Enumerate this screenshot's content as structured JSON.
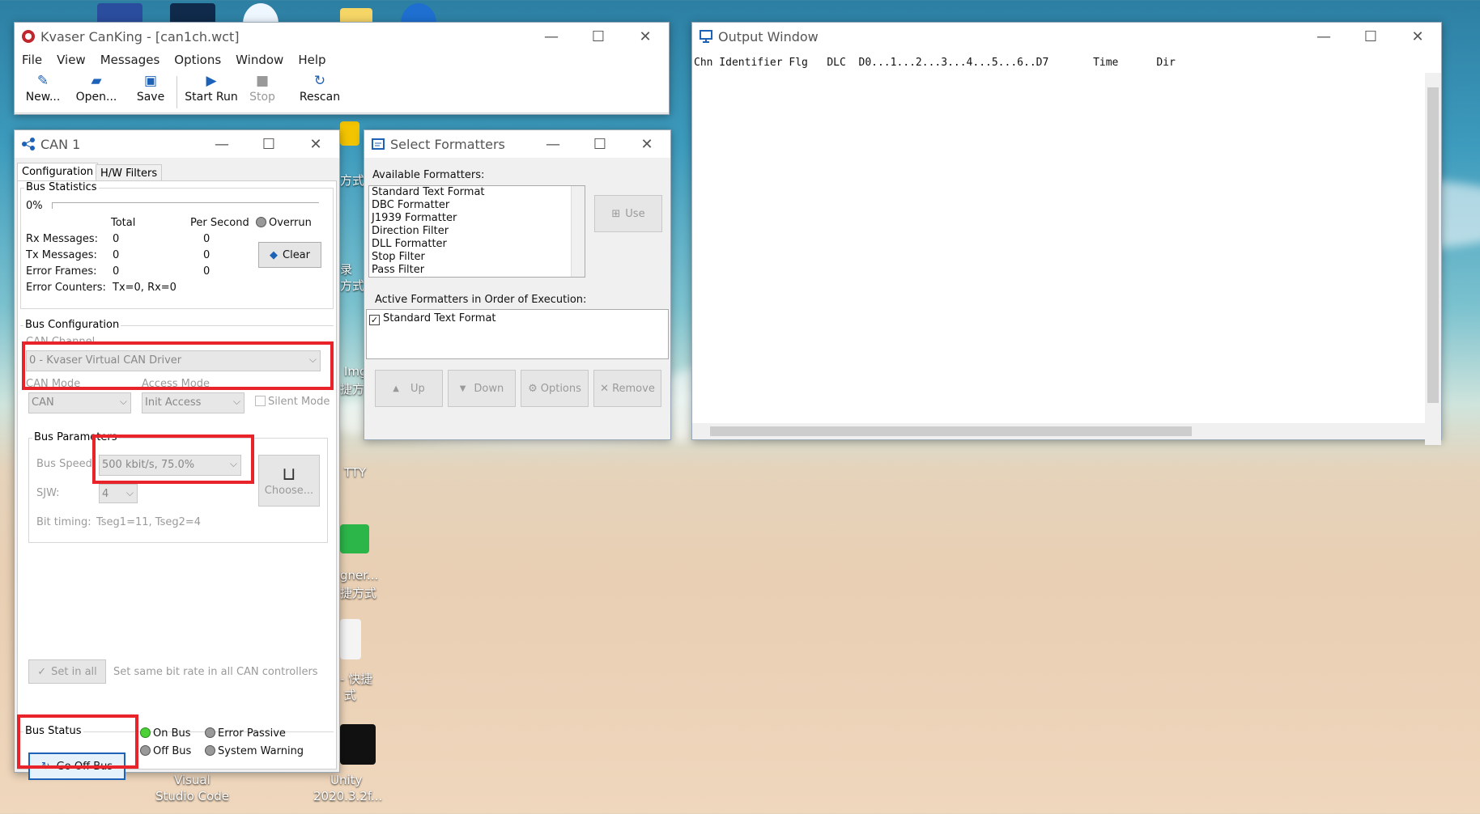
{
  "main_window": {
    "title": "Kvaser CanKing -  [can1ch.wct]",
    "menu": [
      "File",
      "View",
      "Messages",
      "Options",
      "Window",
      "Help"
    ],
    "toolbar": {
      "new": "New...",
      "open": "Open...",
      "save": "Save",
      "start": "Start Run",
      "stop": "Stop",
      "rescan": "Rescan"
    }
  },
  "can1": {
    "title": "CAN 1",
    "tabs": [
      "Configuration",
      "H/W Filters"
    ],
    "bus_stats": {
      "group": "Bus Statistics",
      "percent": "0%",
      "col_total": "Total",
      "col_per_second": "Per Second",
      "overrun": "Overrun",
      "rows": [
        {
          "label": "Rx Messages:",
          "total": "0",
          "per_second": "0"
        },
        {
          "label": "Tx Messages:",
          "total": "0",
          "per_second": "0"
        },
        {
          "label": "Error Frames:",
          "total": "0",
          "per_second": "0"
        }
      ],
      "error_counters_label": "Error Counters:",
      "error_counters_value": "Tx=0, Rx=0",
      "clear": "Clear"
    },
    "bus_config": {
      "group": "Bus Configuration",
      "can_channel_label": "CAN Channel",
      "can_channel_value": "0 - Kvaser Virtual CAN Driver",
      "can_mode_label": "CAN Mode",
      "access_mode_label": "Access Mode",
      "can_mode_value": "CAN",
      "access_mode_value": "Init Access",
      "silent_mode": "Silent Mode",
      "bus_params_group": "Bus Parameters",
      "bus_speed_label": "Bus Speed:",
      "bus_speed_value": "500 kbit/s, 75.0%",
      "sjw_label": "SJW:",
      "sjw_value": "4",
      "choose": "Choose...",
      "bit_timing_label": "Bit timing:",
      "bit_timing_value": "Tseg1=11, Tseg2=4",
      "set_in_all": "Set in all",
      "set_same_text": "Set same bit rate in all CAN controllers"
    },
    "bus_status": {
      "group": "Bus Status",
      "go_off_bus": "Go Off Bus",
      "on_bus": "On Bus",
      "off_bus": "Off Bus",
      "error_passive": "Error Passive",
      "system_warning": "System Warning"
    }
  },
  "formatters": {
    "title": "Select Formatters",
    "available_label": "Available Formatters:",
    "available": [
      "Standard Text Format",
      "DBC Formatter",
      "J1939 Formatter",
      "Direction Filter",
      "DLL Formatter",
      "Stop Filter",
      "Pass Filter"
    ],
    "use": "Use",
    "active_label": "Active Formatters in Order of Execution:",
    "active": [
      "Standard Text Format"
    ],
    "buttons": {
      "up": "Up",
      "down": "Down",
      "options": "Options",
      "remove": "Remove"
    }
  },
  "output": {
    "title": "Output Window",
    "header": "Chn Identifier Flg   DLC  D0...1...2...3...4...5...6..D7       Time      Dir"
  },
  "desktop_labels": [
    "方式",
    "录",
    "方式",
    "Img",
    "捷方",
    "TTY",
    "gner...",
    "捷方式",
    "- 快捷",
    "式",
    "Visual",
    "Studio Code",
    "Unity",
    "2020.3.2f..."
  ],
  "colors": {
    "highlight": "#e8232a",
    "accent": "#1e62b8",
    "on_bus": "#4cd137"
  }
}
